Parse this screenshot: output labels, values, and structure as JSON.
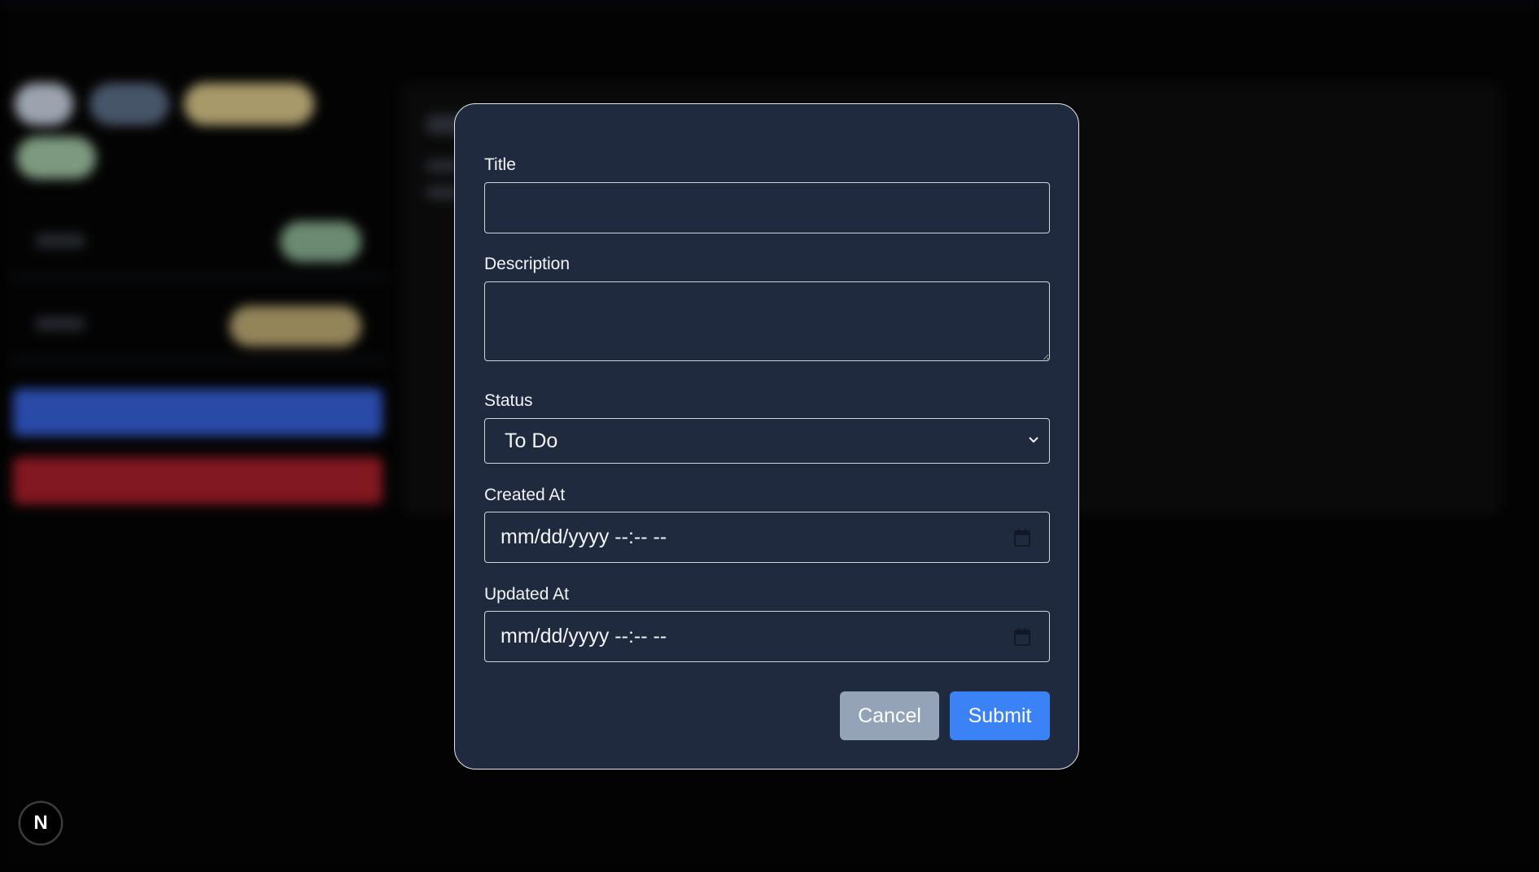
{
  "form": {
    "title_label": "Title",
    "title_value": "",
    "description_label": "Description",
    "description_value": "",
    "status_label": "Status",
    "status_value": "To Do",
    "created_at_label": "Created At",
    "created_at_placeholder": "mm/dd/yyyy --:-- --",
    "updated_at_label": "Updated At",
    "updated_at_placeholder": "mm/dd/yyyy --:-- --",
    "cancel_label": "Cancel",
    "submit_label": "Submit"
  },
  "next_badge": {
    "label": "N"
  },
  "colors": {
    "modal_bg": "#1f2a3f",
    "submit": "#3b82f6",
    "cancel": "#94a3b8",
    "page_bg": "#000000"
  },
  "icons": {
    "status_dropdown": "chevron-down-icon",
    "created_at_picker": "calendar-icon",
    "updated_at_picker": "calendar-icon"
  }
}
